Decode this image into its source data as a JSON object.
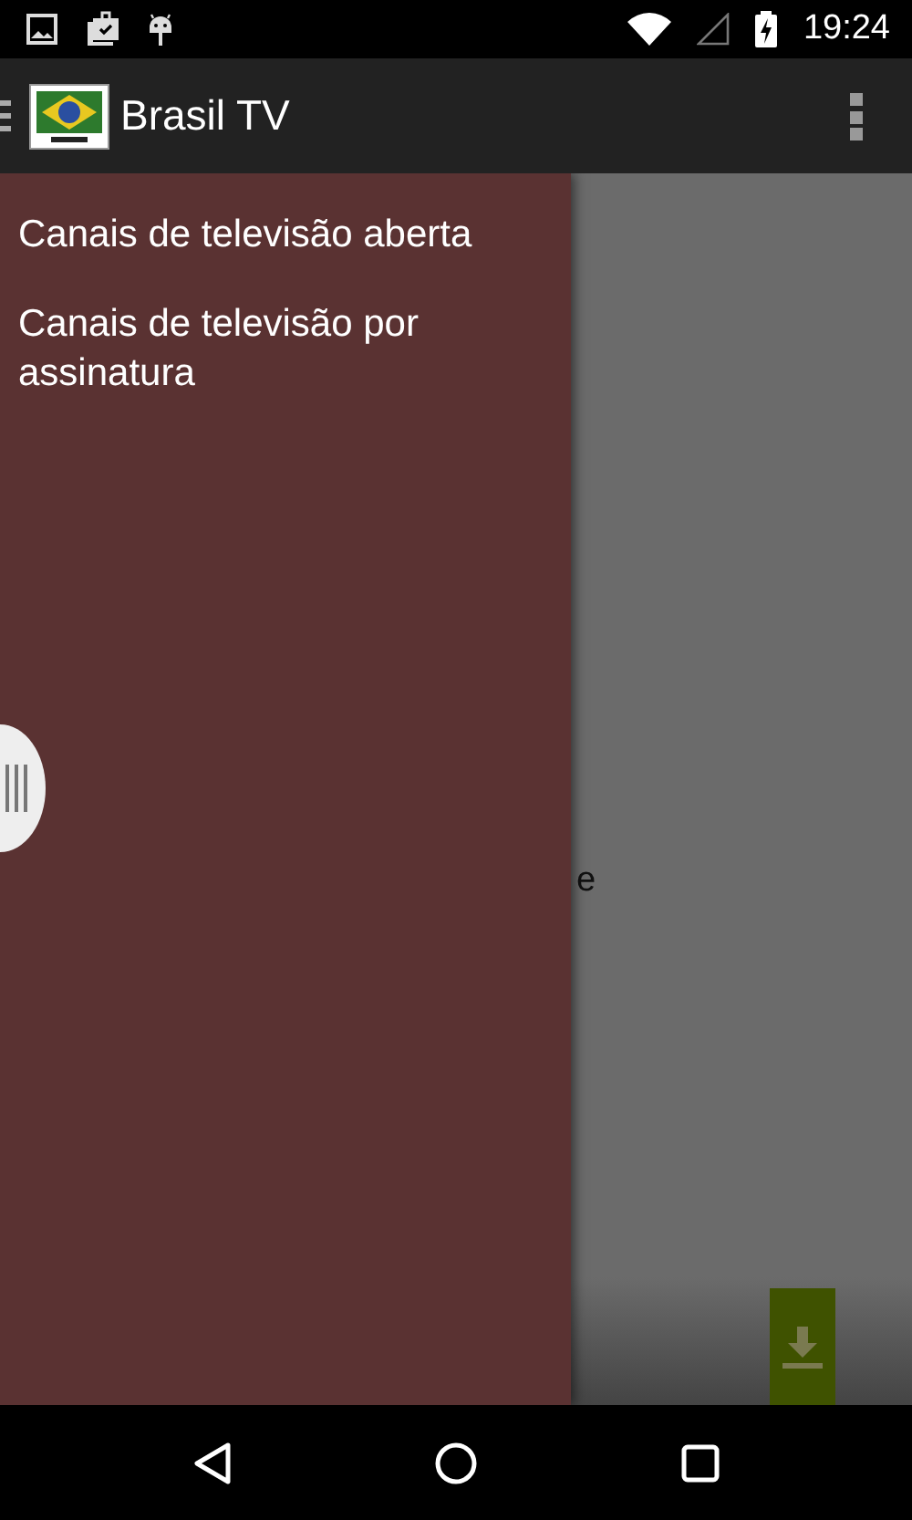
{
  "status_bar": {
    "time": "19:24"
  },
  "app_bar": {
    "title": "Brasil TV"
  },
  "drawer": {
    "items": [
      {
        "label": "Canais de televisão aberta"
      },
      {
        "label": "Canais de televisão por assinatura"
      }
    ]
  },
  "content": {
    "text": "e"
  }
}
